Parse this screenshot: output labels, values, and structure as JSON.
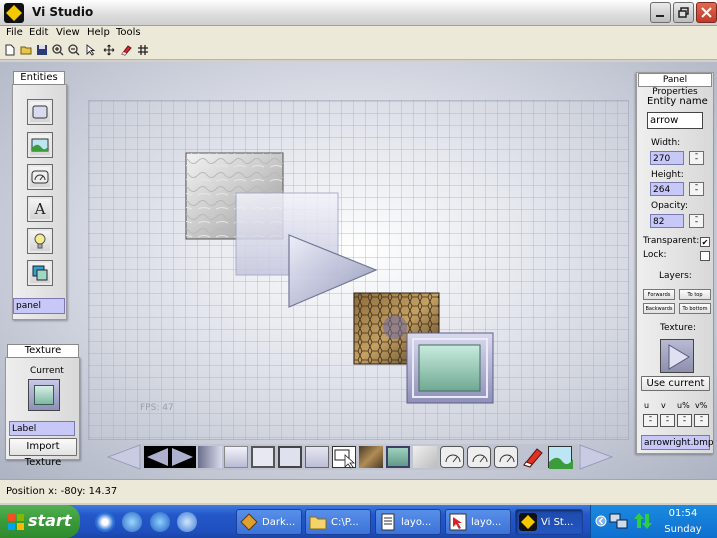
{
  "window": {
    "title": "Vi Studio"
  },
  "menu": [
    "File",
    "Edit",
    "View",
    "Help",
    "Tools"
  ],
  "toolbar_icons": [
    "new-icon",
    "open-icon",
    "save-icon",
    "zoom-in-icon",
    "zoom-out-icon",
    "select-icon",
    "move-icon",
    "eraser-icon",
    "grid-icon"
  ],
  "entities": {
    "tab": "Entities",
    "buttons": [
      "panel-entity-icon",
      "image-entity-icon",
      "gauge-entity-icon",
      "text-entity-icon",
      "light-entity-icon",
      "layer-entity-icon"
    ],
    "text_letter": "A",
    "selected_type": "panel"
  },
  "texture_panel": {
    "tab": "Texture",
    "current_label": "Current",
    "selected_value": "Label",
    "import_button": "Import Texture"
  },
  "canvas": {
    "fps_text": "FPS: 47"
  },
  "properties": {
    "tab": "Panel Properties",
    "entity_name_label": "Entity name",
    "entity_name_value": "arrow",
    "width_label": "Width:",
    "width_value": "270",
    "height_label": "Height:",
    "height_value": "264",
    "opacity_label": "Opacity:",
    "opacity_value": "82",
    "transparent_label": "Transparent:",
    "transparent_checked": "✔",
    "lock_label": "Lock:",
    "layers_label": "Layers:",
    "forwards": "Forwards",
    "to_top": "To top",
    "backwards": "Backwards",
    "to_bottom": "To bottom",
    "texture_label": "Texture:",
    "use_current": "Use current",
    "uv_labels": [
      "u",
      "v",
      "u%",
      "v%"
    ],
    "texture_file": "arrowright.bmp"
  },
  "status": {
    "position_text": "Position x: -80y: 14.37"
  },
  "taskbar": {
    "start": "start",
    "tasks": [
      "Dark...",
      "C:\\P...",
      "layo...",
      "layo...",
      "Vi St..."
    ],
    "clock_time": "01:54",
    "clock_day": "Sunday"
  },
  "colors": {
    "accent_field": "#c8c8f8",
    "taskbar_blue": "#2457c9",
    "start_green": "#3a9a3a"
  }
}
